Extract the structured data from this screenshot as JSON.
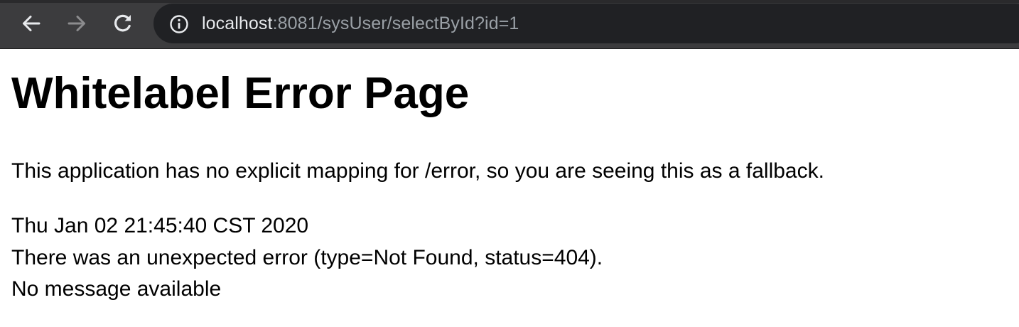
{
  "browser": {
    "url_host": "localhost",
    "url_rest": ":8081/sysUser/selectById?id=1",
    "colors": {
      "toolbar": "#3c3c3e",
      "omnibox": "#202124",
      "url_host": "#e8eaed",
      "url_rest": "#9aa0a6"
    },
    "icons": [
      "back-arrow-icon",
      "forward-arrow-icon",
      "reload-icon",
      "info-icon"
    ]
  },
  "page": {
    "title": "Whitelabel Error Page",
    "explanation": "This application has no explicit mapping for /error, so you are seeing this as a fallback.",
    "timestamp": "Thu Jan 02 21:45:40 CST 2020",
    "error_line": "There was an unexpected error (type=Not Found, status=404).",
    "message": "No message available"
  }
}
